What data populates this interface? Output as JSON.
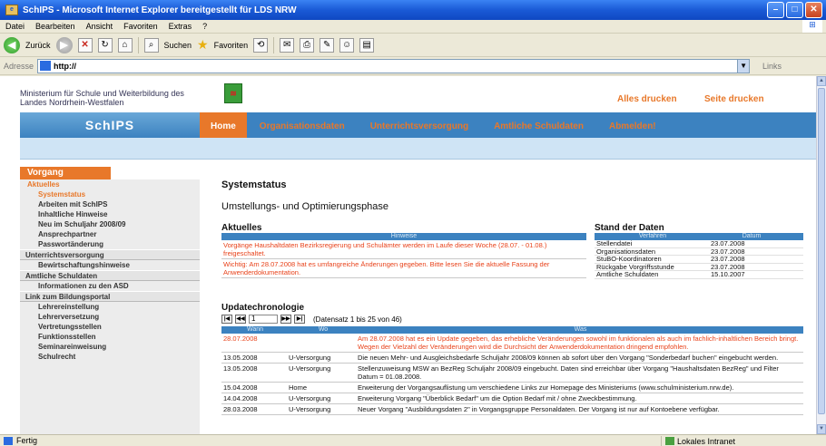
{
  "window": {
    "title": "SchIPS - Microsoft Internet Explorer bereitgestellt für LDS NRW"
  },
  "menubar": [
    "Datei",
    "Bearbeiten",
    "Ansicht",
    "Favoriten",
    "Extras",
    "?"
  ],
  "toolbar": {
    "back_label": "Zurück",
    "search_label": "Suchen",
    "favorites_label": "Favoriten"
  },
  "addressbar": {
    "label": "Adresse",
    "value": "http://",
    "links_label": "Links"
  },
  "header": {
    "ministry_line1": "Ministerium für Schule und Weiterbildung des",
    "ministry_line2": "Landes Nordrhein-Westfalen",
    "print_all": "Alles drucken",
    "print_page": "Seite drucken",
    "logo": "SchIPS"
  },
  "nav": {
    "tabs": [
      "Home",
      "Organisationsdaten",
      "Unterrichtsversorgung",
      "Amtliche Schuldaten",
      "Abmelden!"
    ]
  },
  "sidebar": {
    "title": "Vorgang",
    "sub": "Aktuelles",
    "items_aktuelles": [
      "Systemstatus",
      "Arbeiten mit SchIPS",
      "Inhaltliche Hinweise",
      "Neu im Schuljahr 2008/09",
      "Ansprechpartner",
      "Passwortänderung"
    ],
    "group_unterricht": "Unterrichtsversorgung",
    "items_unterricht": [
      "Bewirtschaftungshinweise"
    ],
    "group_amtlich": "Amtliche Schuldaten",
    "items_amtlich": [
      "Informationen zu den ASD"
    ],
    "group_link": "Link zum Bildungsportal",
    "items_link": [
      "Lehrereinstellung",
      "Lehrerversetzung",
      "Vertretungsstellen",
      "Funktionsstellen",
      "Seminareinweisung",
      "Schulrecht"
    ]
  },
  "main": {
    "title": "Systemstatus",
    "phase": "Umstellungs- und Optimierungsphase",
    "aktuelles": {
      "title": "Aktuelles",
      "header": "Hinweise",
      "text1": "Vorgänge Haushaltdaten Bezirksregierung und Schulämter werden im Laufe dieser Woche (28.07. - 01.08.) freigeschaltet.",
      "text2": "Wichtig: Am 28.07.2008 hat es umfangreiche Änderungen gegeben. Bitte lesen Sie die aktuelle Fassung der Anwenderdokumentation."
    },
    "stand": {
      "title": "Stand der Daten",
      "col1": "Verfahren",
      "col2": "Datum",
      "rows": [
        {
          "name": "Stellendatei",
          "date": "23.07.2008"
        },
        {
          "name": "Organisationsdaten",
          "date": "23.07.2008"
        },
        {
          "name": "StuBO-Koordinatoren",
          "date": "23.07.2008"
        },
        {
          "name": "Rückgabe Vorgriffsstunde",
          "date": "23.07.2008"
        },
        {
          "name": "Amtliche Schuldaten",
          "date": "15.10.2007"
        }
      ]
    },
    "updates": {
      "title": "Updatechronologie",
      "page_value": "1",
      "info": "(Datensatz 1 bis 25 von 46)",
      "col_when": "Wann",
      "col_where": "Wo",
      "col_what": "Was",
      "rows": [
        {
          "when": "28.07.2008",
          "where": "",
          "what": "Am 28.07.2008 hat es ein Update gegeben, das erhebliche Veränderungen sowohl im funktionalen als auch im fachlich-inhaltlichen Bereich bringt. Wegen der Vielzahl der Veränderungen wird die Durchsicht der Anwenderdokumentation dringend empfohlen."
        },
        {
          "when": "13.05.2008",
          "where": "U-Versorgung",
          "what": "Die neuen Mehr- und Ausgleichsbedarfe Schuljahr 2008/09 können ab sofort über den Vorgang \"Sonderbedarf buchen\" eingebucht werden."
        },
        {
          "when": "13.05.2008",
          "where": "U-Versorgung",
          "what": "Stellenzuweisung MSW an BezReg Schuljahr 2008/09 eingebucht. Daten sind erreichbar über Vorgang \"Haushaltsdaten BezReg\" und Filter Datum = 01.08.2008."
        },
        {
          "when": "15.04.2008",
          "where": "Home",
          "what": "Erweiterung der Vorgangsauflistung um verschiedene Links zur Homepage des Ministeriums (www.schulministerium.nrw.de)."
        },
        {
          "when": "14.04.2008",
          "where": "U-Versorgung",
          "what": "Erweiterung Vorgang \"Überblick Bedarf\" um die Option Bedarf mit / ohne Zweckbestimmung."
        },
        {
          "when": "28.03.2008",
          "where": "U-Versorgung",
          "what": "Neuer Vorgang \"Ausbildungsdaten 2\" in Vorgangsgruppe Personaldaten. Der Vorgang ist nur auf Kontoebene verfügbar."
        }
      ]
    }
  },
  "statusbar": {
    "text": "Fertig",
    "zone": "Lokales Intranet"
  },
  "colors": {
    "accent_orange": "#e8782a",
    "nav_blue": "#3c82c0",
    "highlight_red": "#e8421a"
  }
}
